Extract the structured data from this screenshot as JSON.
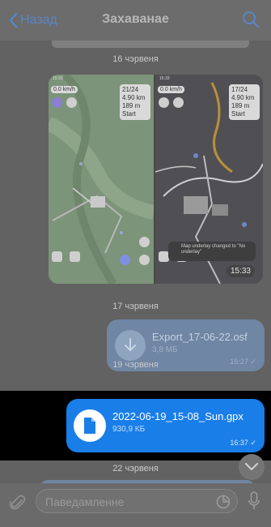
{
  "header": {
    "back_label": "Назад",
    "title": "Захаванае"
  },
  "dates": {
    "d1": "16 чэрвеня",
    "d2": "17 чэрвеня",
    "d3": "19 чэрвеня",
    "d4": "22 чэрвеня"
  },
  "album": {
    "left_screen": {
      "status": "15:33",
      "speed": "0.0 km/h",
      "stat_count": "21/24",
      "distance": "4.90 km",
      "elevation": "189 m",
      "start": "Start"
    },
    "right_screen": {
      "status": "15:33",
      "speed": "0.0 km/h",
      "stat_count": "17/24",
      "distance": "4.90 km",
      "elevation": "189 m",
      "start": "Start",
      "toast": "Map underlay changed to \"No underlay\""
    },
    "time": "15:33"
  },
  "messages": [
    {
      "file_name": "Export_17-06-22.osf",
      "size": "3,8 МБ",
      "time": "15:27"
    },
    {
      "file_name": "2022-06-19_15-08_Sun.gpx",
      "size": "930,9 КБ",
      "time": "16:37"
    }
  ],
  "composer": {
    "placeholder": "Паведамленне"
  },
  "colors": {
    "accent": "#1a7ee8",
    "dim_overlay": "#626262"
  },
  "icons": [
    "chevron-left-icon",
    "search-icon",
    "download-icon",
    "document-icon",
    "chevron-down-icon",
    "paperclip-icon",
    "sticker-icon",
    "mic-icon"
  ]
}
